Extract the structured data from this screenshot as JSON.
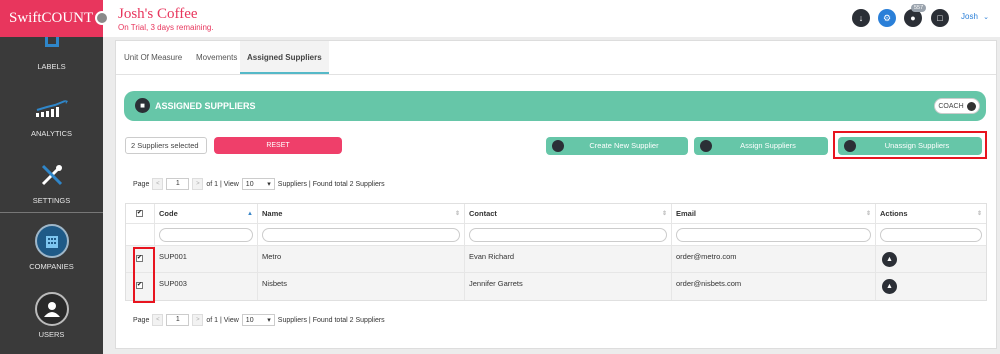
{
  "brand": {
    "name": "SwiftCOUNT"
  },
  "org": {
    "name": "Josh's Coffee",
    "trial_notice": "On Trial, 3 days remaining."
  },
  "topbar": {
    "badge_count": "557",
    "user_name": "Josh",
    "icons": [
      "download-icon",
      "settings-icon",
      "notification-icon",
      "clipboard-icon"
    ]
  },
  "sidebar": {
    "items": [
      {
        "label": "LABELS",
        "icon": "labels-icon"
      },
      {
        "label": "ANALYTICS",
        "icon": "analytics-icon"
      },
      {
        "label": "SETTINGS",
        "icon": "settings-icon"
      },
      {
        "label": "COMPANIES",
        "icon": "companies-icon"
      },
      {
        "label": "USERS",
        "icon": "users-icon"
      }
    ]
  },
  "tabs": [
    {
      "label": "Unit Of Measure",
      "active": false
    },
    {
      "label": "Movements",
      "active": false
    },
    {
      "label": "Assigned Suppliers",
      "active": true
    }
  ],
  "section": {
    "title": "ASSIGNED SUPPLIERS",
    "coach_label": "COACH"
  },
  "toolbar": {
    "selected_text": "2 Suppliers selected",
    "reset_label": "RESET",
    "create_label": "Create New Supplier",
    "assign_label": "Assign Suppliers",
    "unassign_label": "Unassign Suppliers"
  },
  "pager": {
    "page_label": "Page",
    "prev": "<",
    "page": "1",
    "next": ">",
    "of_text": "of 1 | View",
    "per_page": "10",
    "found_text": "Suppliers | Found total 2 Suppliers"
  },
  "table": {
    "columns": [
      "Code",
      "Name",
      "Contact",
      "Email",
      "Actions"
    ],
    "rows": [
      {
        "code": "SUP001",
        "name": "Metro",
        "contact": "Evan Richard",
        "email": "order@metro.com",
        "checked": true
      },
      {
        "code": "SUP003",
        "name": "Nisbets",
        "contact": "Jennifer Garrets",
        "email": "order@nisbets.com",
        "checked": true
      }
    ]
  },
  "colors": {
    "brand": "#e8365d",
    "accent_green": "#66c6a8",
    "reset": "#ef3f6a",
    "sidebar": "#3a3a3a",
    "highlight": "#e8141f"
  }
}
